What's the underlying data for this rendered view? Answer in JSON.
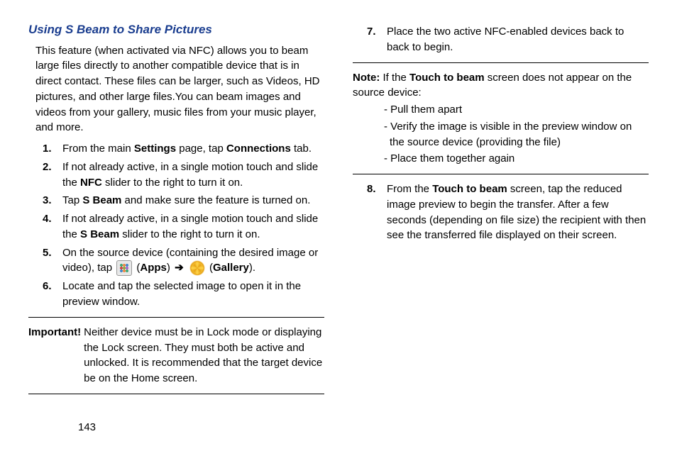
{
  "heading": "Using S Beam to Share Pictures",
  "intro": "This feature (when activated via NFC) allows you to beam large files directly to another compatible device that is in direct contact. These files can be larger, such as Videos, HD pictures, and other large files.You can beam images and videos from your gallery, music files from your music player, and more.",
  "steps": {
    "s1": {
      "num": "1.",
      "pre": "From the main ",
      "b1": "Settings",
      "mid": " page, tap ",
      "b2": "Connections",
      "post": " tab."
    },
    "s2": {
      "num": "2.",
      "pre": "If not already active, in a single motion touch and slide the ",
      "b1": "NFC",
      "post": " slider to the right to turn it on."
    },
    "s3": {
      "num": "3.",
      "pre": "Tap ",
      "b1": "S Beam",
      "post": " and make sure the feature is turned on."
    },
    "s4": {
      "num": "4.",
      "pre": "If not already active, in a single motion touch and slide the ",
      "b1": "S Beam",
      "post": " slider to the right to turn it on."
    },
    "s5": {
      "num": "5.",
      "pre": "On the source device (containing the desired image or video), tap ",
      "apps_open": " (",
      "b1": "Apps",
      "apps_close": ") ",
      "arrow": "➔",
      "gal_open": " (",
      "b2": "Gallery",
      "gal_close": ")."
    },
    "s6": {
      "num": "6.",
      "text": "Locate and tap the selected image to open it in the preview window."
    },
    "s7": {
      "num": "7.",
      "text": "Place the two active NFC-enabled devices back to back to begin."
    },
    "s8": {
      "num": "8.",
      "pre": "From the ",
      "b1": "Touch to beam",
      "post": " screen, tap the reduced image preview to begin the transfer. After a few seconds (depending on file size) the recipient with then see the transferred file displayed on their screen."
    }
  },
  "important": {
    "label": "Important! ",
    "text": "Neither device must be in Lock mode or displaying the Lock screen. They must both be active and unlocked. It is recommended that the target device be on the Home screen."
  },
  "note": {
    "label": "Note: ",
    "pre": "If the ",
    "b1": "Touch to beam",
    "post": " screen does not appear on the source device:",
    "items": {
      "i1": "- Pull them apart",
      "i2": "- Verify the image is visible in the preview window on the source device (providing the file)",
      "i3": "- Place them together again"
    }
  },
  "page": "143"
}
